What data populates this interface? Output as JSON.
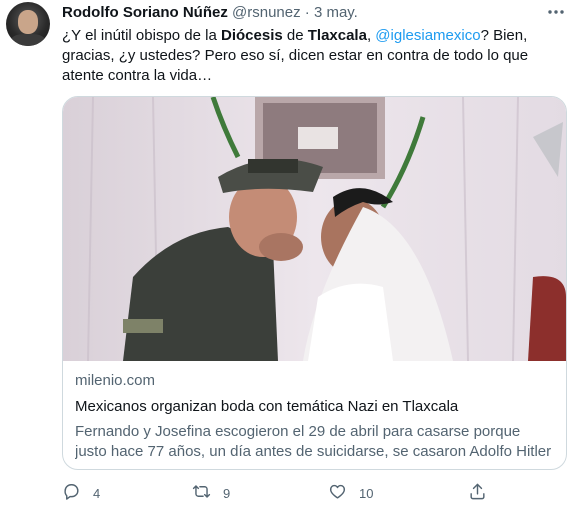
{
  "author": {
    "name": "Rodolfo Soriano Núñez",
    "handle": "@rsnunez",
    "separator": "·",
    "time": "3 may."
  },
  "tweet": {
    "part1": "¿Y el inútil obispo de la ",
    "bold1": "Diócesis",
    "part2": " de ",
    "bold2": "Tlaxcala",
    "part3": ", ",
    "mention": "@iglesiamexico",
    "part4": "? Bien, gracias, ¿y ustedes? Pero eso sí, dicen estar en contra de todo lo que atente contra la vida…"
  },
  "card": {
    "domain": "milenio.com",
    "title": "Mexicanos organizan boda con temática Nazi en Tlaxcala",
    "description": "Fernando y Josefina escogieron el 29 de abril para casarse porque justo hace 77 años, un día antes de suicidarse, se casaron Adolfo Hitler y E…"
  },
  "actions": {
    "replies": "4",
    "retweets": "9",
    "likes": "10"
  },
  "icons": {
    "more": "more-dots-icon",
    "reply": "reply-bubble-icon",
    "retweet": "retweet-arrows-icon",
    "like": "heart-icon",
    "share": "share-upload-icon"
  },
  "colors": {
    "text": "#0f1419",
    "secondary": "#536471",
    "link": "#1d9bf0",
    "border": "#cfd9de"
  }
}
